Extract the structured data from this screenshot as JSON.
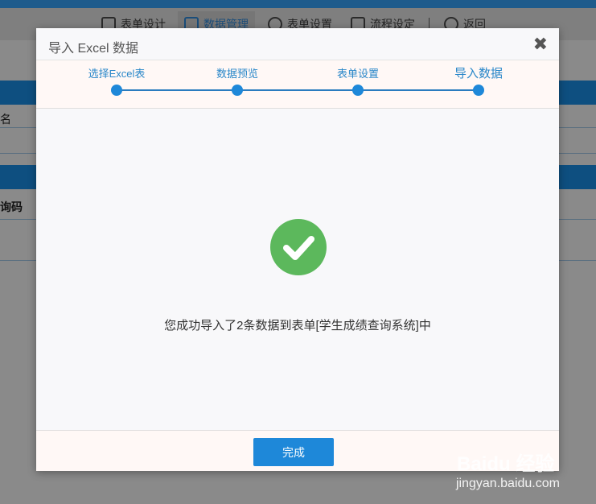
{
  "background": {
    "toolbar": {
      "tabs": [
        {
          "label": "表单设计"
        },
        {
          "label": "数据管理"
        },
        {
          "label": "表单设置"
        },
        {
          "label": "流程设定"
        },
        {
          "label": "返回"
        }
      ]
    },
    "panel_labels": [
      "名",
      "询码"
    ]
  },
  "modal": {
    "title": "导入 Excel 数据",
    "close_symbol": "✖",
    "steps": [
      {
        "label": "选择Excel表"
      },
      {
        "label": "数据预览"
      },
      {
        "label": "表单设置"
      },
      {
        "label": "导入数据"
      }
    ],
    "current_step": 4,
    "message": "您成功导入了2条数据到表单[学生成绩查询系统]中",
    "finish_label": "完成"
  },
  "watermark": {
    "logo": "Baidu 经验",
    "url": "jingyan.baidu.com"
  },
  "colors": {
    "accent": "#1e88d9",
    "success": "#5cb85c",
    "step_text": "#2a87c9"
  }
}
